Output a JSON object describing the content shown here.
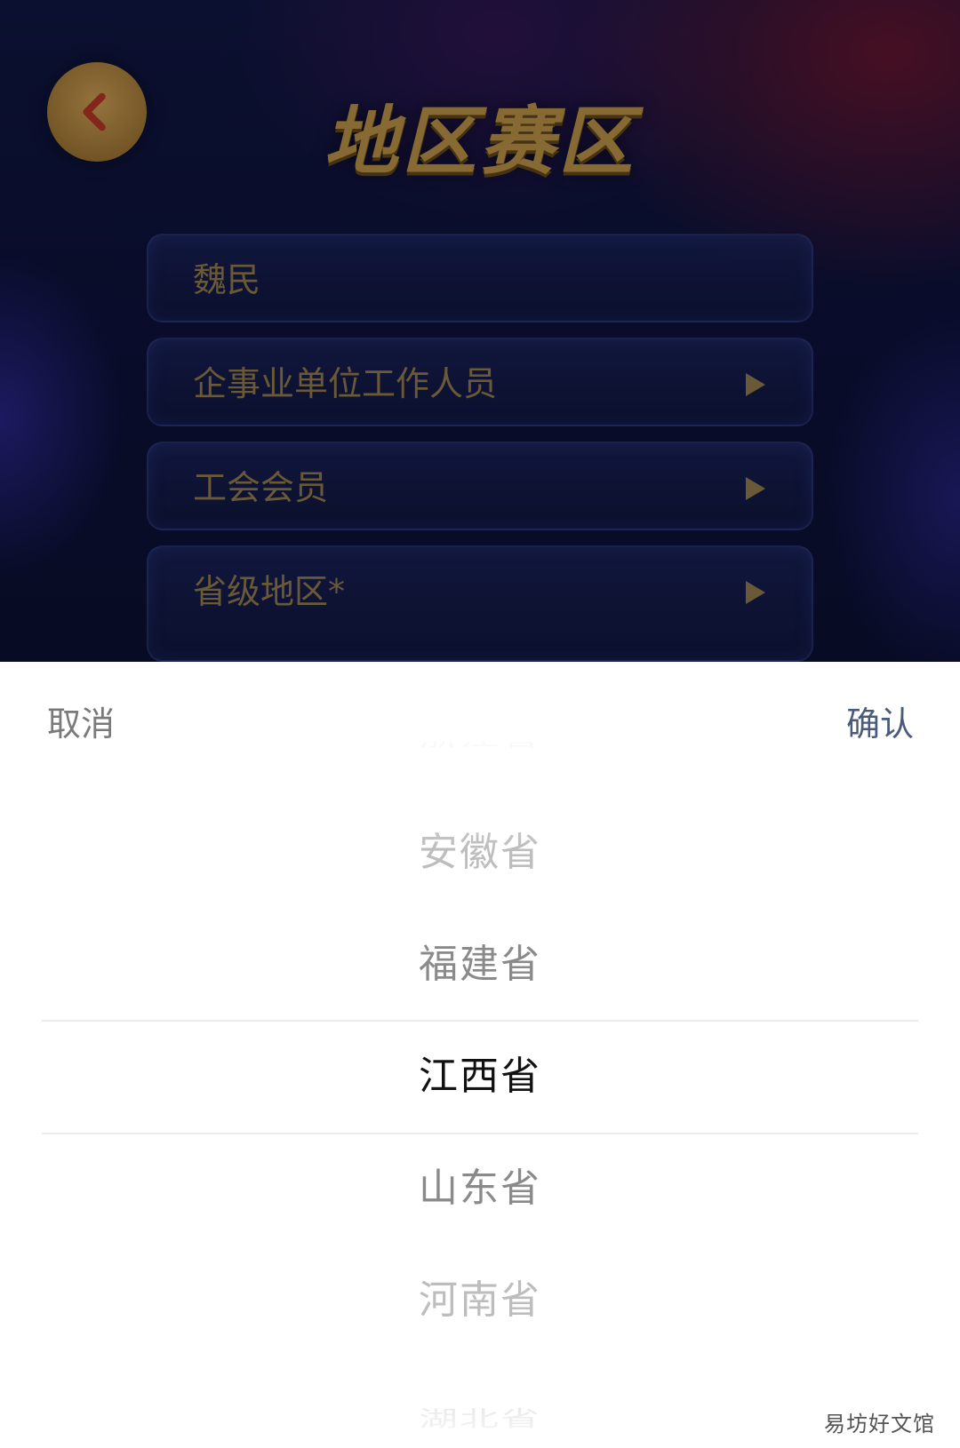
{
  "page": {
    "title": "地区赛区"
  },
  "form": {
    "fields": [
      {
        "label": "魏民",
        "has_arrow": false
      },
      {
        "label": "企事业单位工作人员",
        "has_arrow": true
      },
      {
        "label": "工会会员",
        "has_arrow": true
      },
      {
        "label": "省级地区*",
        "has_arrow": true
      }
    ]
  },
  "picker": {
    "cancel_label": "取消",
    "confirm_label": "确认",
    "options": [
      "浙江省",
      "安徽省",
      "福建省",
      "江西省",
      "山东省",
      "河南省",
      "湖北省"
    ],
    "selected": "江西省"
  },
  "watermark": "易坊好文馆",
  "colors": {
    "accent_gold": "#b38d45",
    "picker_selected": "#111111",
    "picker_near": "#8a8a8a",
    "picker_far": "#bdbdbd"
  }
}
